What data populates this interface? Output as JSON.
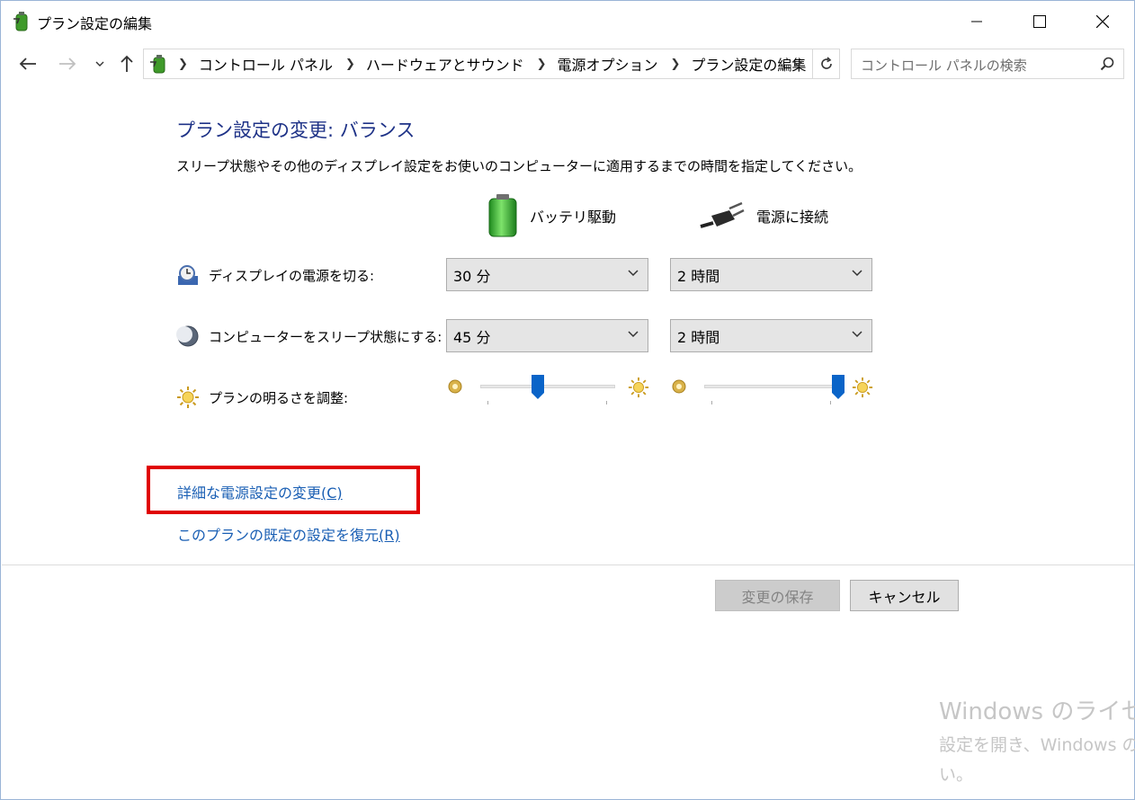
{
  "window": {
    "title": "プラン設定の編集"
  },
  "nav": {
    "breadcrumbs": [
      "コントロール パネル",
      "ハードウェアとサウンド",
      "電源オプション",
      "プラン設定の編集"
    ],
    "search_placeholder": "コントロール パネルの検索"
  },
  "content": {
    "heading": "プラン設定の変更: バランス",
    "description": "スリープ状態やその他のディスプレイ設定をお使いのコンピューターに適用するまでの時間を指定してください。",
    "columns": {
      "battery_label": "バッテリ駆動",
      "plugged_label": "電源に接続"
    },
    "rows": {
      "display_off": {
        "label": "ディスプレイの電源を切る:",
        "battery_value": "30 分",
        "plugged_value": "2 時間"
      },
      "sleep": {
        "label": "コンピューターをスリープ状態にする:",
        "battery_value": "45 分",
        "plugged_value": "2 時間"
      },
      "brightness": {
        "label": "プランの明るさを調整:",
        "battery_level": 0.4,
        "plugged_level": 1.0
      }
    },
    "links": {
      "advanced_text": "詳細な電源設定の変更",
      "advanced_key": "(C)",
      "restore_text": "このプランの既定の設定を復元",
      "restore_key": "(R)"
    }
  },
  "buttons": {
    "save": "変更の保存",
    "cancel": "キャンセル"
  },
  "watermark": {
    "line1": "Windows のライセ",
    "line2": "設定を開き、Windows の",
    "line3": "い。"
  },
  "colors": {
    "heading": "#1e3287",
    "link": "#1a5fb4",
    "highlight": "#e00000",
    "slider_thumb": "#0a64c8"
  }
}
